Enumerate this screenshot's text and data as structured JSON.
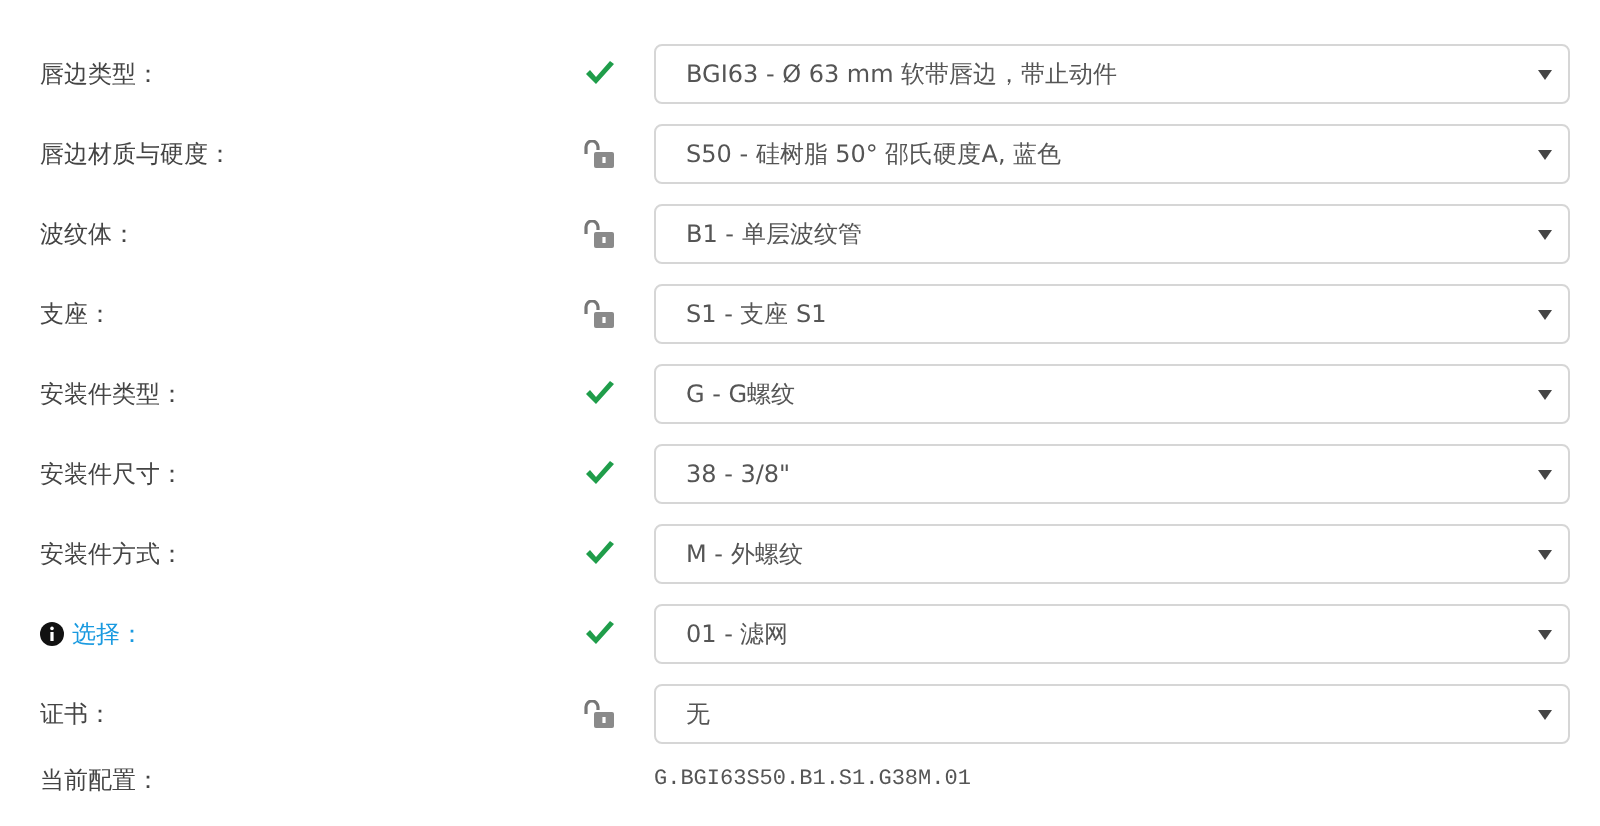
{
  "options": [
    {
      "label": "唇边类型：",
      "kind": "text",
      "confirmed": true,
      "value": "BGI63 - Ø 63 mm 软带唇边，带止动件"
    },
    {
      "label": "唇边材质与硬度：",
      "kind": "text",
      "confirmed": false,
      "value": "S50 - 硅树脂 50° 邵氏硬度A, 蓝色"
    },
    {
      "label": "波纹体：",
      "kind": "text",
      "confirmed": false,
      "value": "B1 - 单层波纹管"
    },
    {
      "label": "支座：",
      "kind": "text",
      "confirmed": false,
      "value": "S1 - 支座 S1"
    },
    {
      "label": "安装件类型：",
      "kind": "text",
      "confirmed": true,
      "value": "G - G螺纹"
    },
    {
      "label": "安装件尺寸：",
      "kind": "text",
      "confirmed": true,
      "value": "38 - 3/8\""
    },
    {
      "label": "安装件方式：",
      "kind": "text",
      "confirmed": true,
      "value": "M - 外螺纹"
    },
    {
      "label": "选择：",
      "kind": "link",
      "confirmed": true,
      "value": "01 - 滤网"
    },
    {
      "label": "证书：",
      "kind": "text",
      "confirmed": false,
      "value": "无"
    }
  ],
  "current": {
    "label": "当前配置：",
    "value": "G.BGI63S50.B1.S1.G38M.01"
  }
}
